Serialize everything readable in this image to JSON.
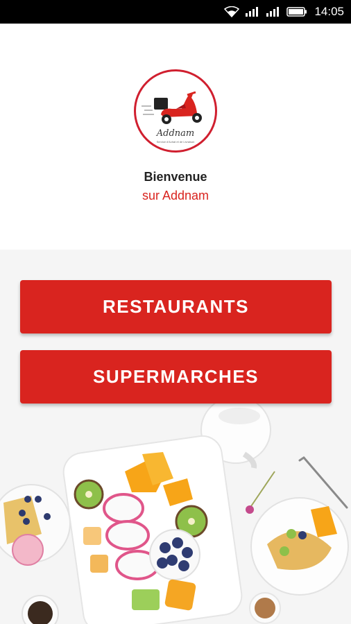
{
  "status_bar": {
    "time": "14:05",
    "icons": [
      "wifi-icon",
      "signal-icon",
      "signal-icon",
      "battery-icon"
    ]
  },
  "logo": {
    "name": "Addnam",
    "tagline": "Service d'Achat et de Livraison"
  },
  "welcome": {
    "title": "Bienvenue",
    "subtitle": "sur Addnam"
  },
  "buttons": {
    "restaurants": "RESTAURANTS",
    "supermarches": "SUPERMARCHES"
  },
  "colors": {
    "accent": "#d9241f",
    "status_bar": "#000000"
  }
}
